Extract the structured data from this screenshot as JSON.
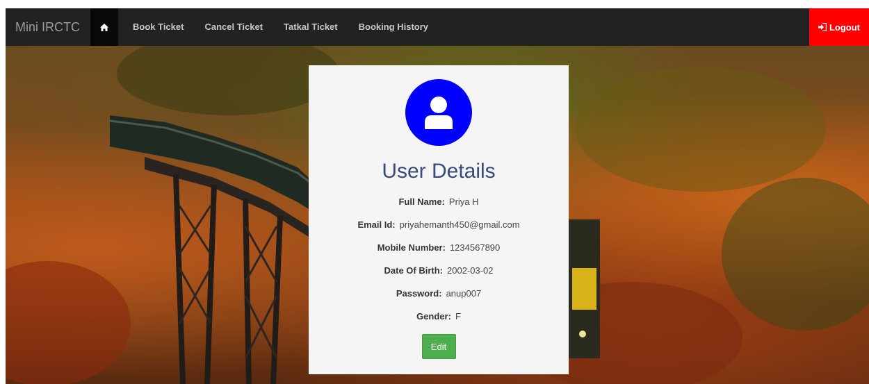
{
  "navbar": {
    "brand": "Mini IRCTC",
    "home_icon": "home-icon",
    "links": [
      "Book Ticket",
      "Cancel Ticket",
      "Tatkal Ticket",
      "Booking History"
    ],
    "logout_label": "Logout",
    "logout_icon": "sign-in-icon",
    "logout_color": "#ff0000"
  },
  "card": {
    "avatar_icon": "user-icon",
    "avatar_color": "#0000ff",
    "title": "User Details",
    "fields": [
      {
        "label": "Full Name:",
        "value": "Priya H"
      },
      {
        "label": "Email Id:",
        "value": "priyahemanth450@gmail.com"
      },
      {
        "label": "Mobile Number:",
        "value": "1234567890"
      },
      {
        "label": "Date Of Birth:",
        "value": "2002-03-02"
      },
      {
        "label": "Password:",
        "value": "anup007"
      },
      {
        "label": "Gender:",
        "value": "F"
      }
    ],
    "edit_label": "Edit",
    "edit_color": "#4cae4c"
  }
}
